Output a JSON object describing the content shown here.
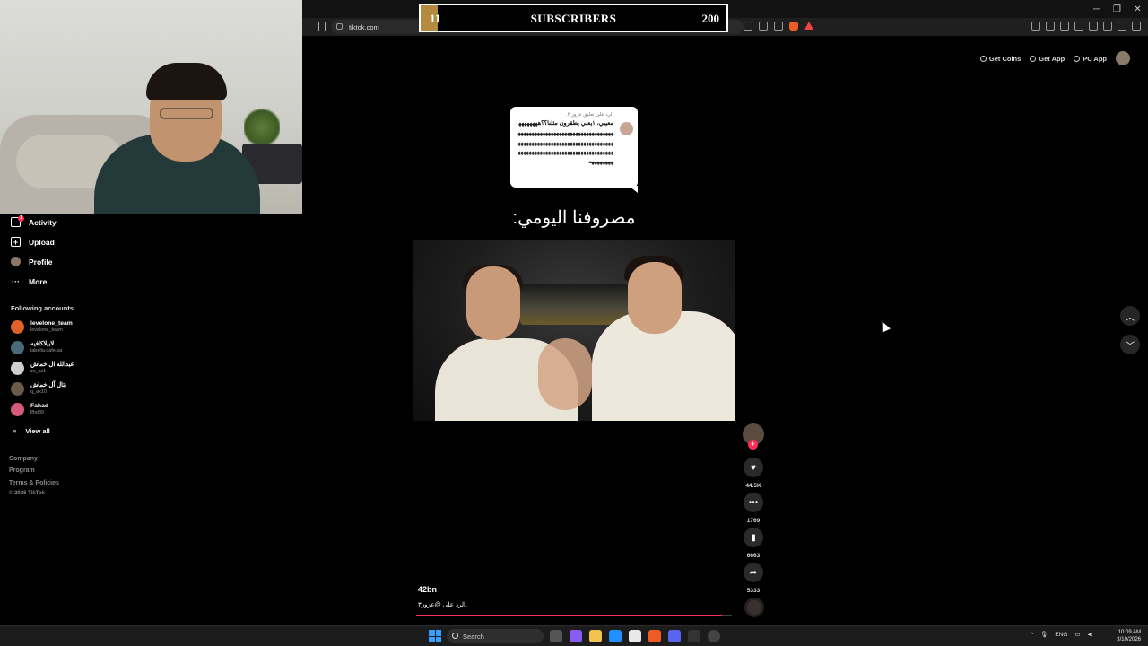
{
  "subscriber_goal": {
    "current": "11",
    "label": "SUBSCRIBERS",
    "goal": "200",
    "progress": 0.055
  },
  "browser": {
    "url": "tiktok.com"
  },
  "header": {
    "get_coins": "Get Coins",
    "get_app": "Get App",
    "pc_app": "PC App"
  },
  "sidebar": {
    "nav": [
      {
        "label": "Activity",
        "icon": "inbox-icon",
        "badge": "1"
      },
      {
        "label": "Upload",
        "icon": "plus-square-icon"
      },
      {
        "label": "Profile",
        "icon": "avatar-icon"
      },
      {
        "label": "More",
        "icon": "more-dots-icon"
      }
    ],
    "following_title": "Following accounts",
    "accounts": [
      {
        "name": "levelone_team",
        "handle": "levelone_team",
        "color": "#e0622a"
      },
      {
        "name": "لابيلاكافيه",
        "handle": "labella.cafe.sa",
        "color": "#4a6a7a"
      },
      {
        "name": "عبدالله ال خماش",
        "handle": "zx_xz1",
        "color": "#cfcfcf"
      },
      {
        "name": "بتال آل خماش",
        "handle": "q_ak10",
        "color": "#6a5a4a"
      },
      {
        "name": "Fahad",
        "handle": "lfhd89",
        "color": "#d45a7a"
      }
    ],
    "view_all": "View all",
    "footer": [
      "Company",
      "Program",
      "Terms & Policies",
      "© 2026 TikTok"
    ]
  },
  "video": {
    "reply_header": "الرد على تعليق عزوز ٣.",
    "reply_text": "معيبي، ١يعني يطقرون مثلنا؟؟هههههههههههههههههههههههههههههههههههههههههههههههههههههههههههههههههههههههههههههههههههههههههههههههههههههههههههههههههههههههههه",
    "overlay_caption": "مصروفنا اليومي:",
    "author": "42bn",
    "description": "الرد على @عزوز٣.",
    "progress": 0.97
  },
  "actions": {
    "likes": "44.5K",
    "comments": "1769",
    "saves": "6663",
    "shares": "5333"
  },
  "taskbar": {
    "search_placeholder": "Search",
    "lang": "ENG",
    "time": "10:09 AM",
    "date": "3/10/2026"
  }
}
